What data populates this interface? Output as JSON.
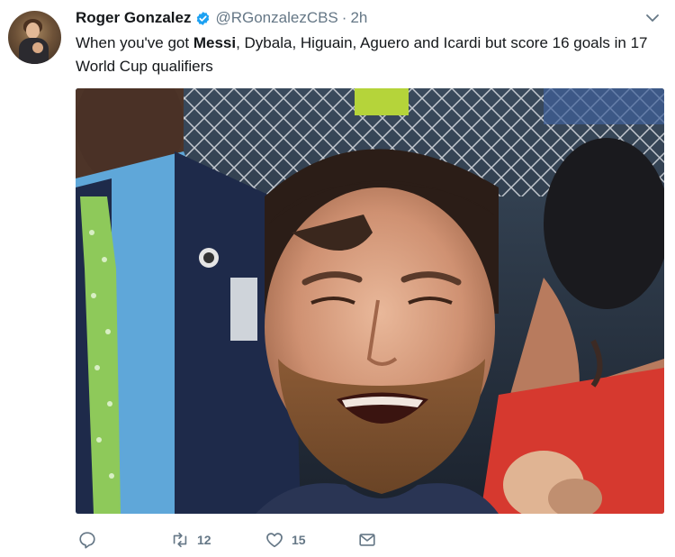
{
  "tweet": {
    "author": {
      "name": "Roger Gonzalez",
      "handle": "@RGonzalezCBS",
      "verified": true
    },
    "separator": "·",
    "time": "2h",
    "text": {
      "prefix": "When you've got ",
      "bold": "Messi",
      "suffix": ", Dybala, Higuain, Aguero and Icardi but score 16 goals in 17 World Cup qualifiers"
    },
    "media": {
      "alt_icon": "photo-crying-soccer-player"
    },
    "actions": {
      "reply_icon": "reply-icon",
      "retweet_count": "12",
      "like_count": "15",
      "message_icon": "message-icon"
    }
  },
  "colors": {
    "text": "#14171a",
    "secondary": "#657786",
    "verified": "#1da1f2"
  }
}
